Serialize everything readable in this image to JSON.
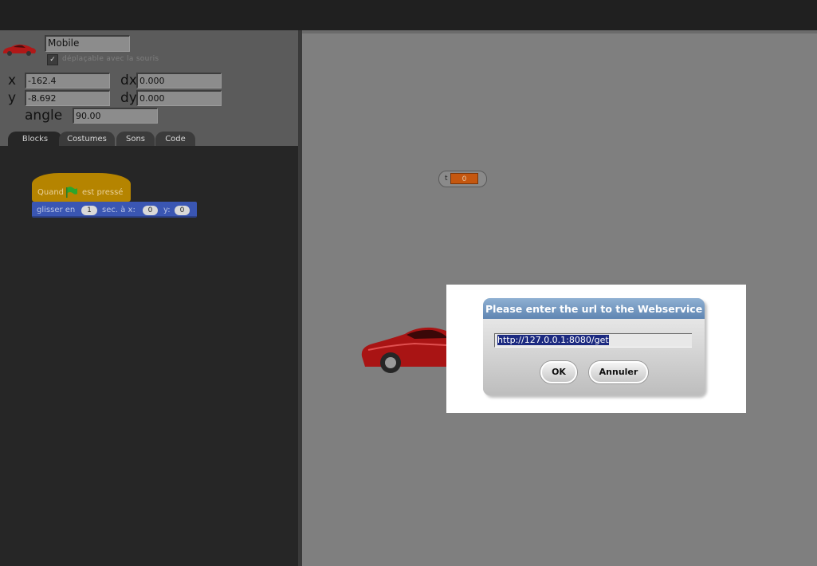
{
  "sprite": {
    "name": "Mobile",
    "draggable_label": "déplaçable avec la souris",
    "draggable_checked": "✓",
    "x_label": "x",
    "x_value": "-162.4",
    "y_label": "y",
    "y_value": "-8.692",
    "dx_label": "dx",
    "dx_value": "0.000",
    "dy_label": "dy",
    "dy_value": "0.000",
    "angle_label": "angle",
    "angle_value": "90.00"
  },
  "tabs": [
    "Blocks",
    "Costumes",
    "Sons",
    "Code"
  ],
  "scripts": {
    "hat_before": "Quand",
    "hat_after": "est pressé",
    "glide_1": "glisser en",
    "glide_secs": "1",
    "glide_2": "sec. à x:",
    "glide_x": "0",
    "glide_3": "y:",
    "glide_y": "0"
  },
  "watcher": {
    "label": "t",
    "value": "0"
  },
  "dialog": {
    "title": "Please enter the url to the Webservice",
    "url_value": "http://127.0.0.1:8080/get",
    "ok_label": "OK",
    "cancel_label": "Annuler"
  },
  "colors": {
    "hat_block": "#b58400",
    "motion_block": "#3a56b3",
    "watcher_value": "#c5570f",
    "dialog_title": "#6a8fbd"
  }
}
